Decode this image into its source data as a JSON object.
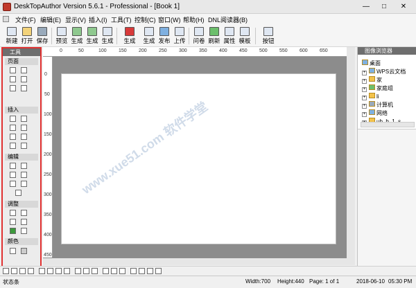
{
  "window": {
    "title": "DeskTopAuthor Version 5.6.1 - Professional - [Book 1]",
    "minimize": "—",
    "maximize": "□",
    "close": "✕"
  },
  "menu": [
    "文件(F)",
    "编辑(E)",
    "显示(V)",
    "插入(I)",
    "工具(T)",
    "控制(C)",
    "窗口(W)",
    "帮助(H)",
    "DNL阅读器(B)"
  ],
  "toolbar": {
    "new": "新建",
    "open": "打开",
    "save": "保存",
    "preview": "预览",
    "gen1": "生成",
    "gen2": "生成",
    "gen3": "生成",
    "gen4": "生成",
    "gen5": "生成",
    "publish": "发布",
    "upload": "上传",
    "quiz": "问卷",
    "refresh": "刷新",
    "props": "属性",
    "template": "模板",
    "button": "按钮"
  },
  "toolbox": {
    "title": "工具",
    "sections": {
      "page": "页面",
      "insert": "插入",
      "edit": "编辑",
      "adjust": "调整",
      "color": "颜色"
    }
  },
  "ruler": {
    "top": [
      "0",
      "50",
      "100",
      "150",
      "200",
      "250",
      "300",
      "350",
      "400",
      "450",
      "500",
      "550",
      "600",
      "650"
    ],
    "left": [
      "0",
      "50",
      "100",
      "150",
      "200",
      "250",
      "300",
      "350",
      "400",
      "450"
    ]
  },
  "browser": {
    "title": "图像浏览器",
    "tree": [
      "桌面",
      "WPS云文档",
      "家",
      "家庭组",
      "li",
      "计算机",
      "网络",
      "ub_b_1_s..."
    ]
  },
  "status": {
    "left": "状态条",
    "width": "Width:700",
    "height": "Height:440",
    "page": "Page: 1 of 1",
    "date": "2018-06-10",
    "time": "05:30 PM"
  },
  "watermark": "www.xue51.com 软件学堂"
}
